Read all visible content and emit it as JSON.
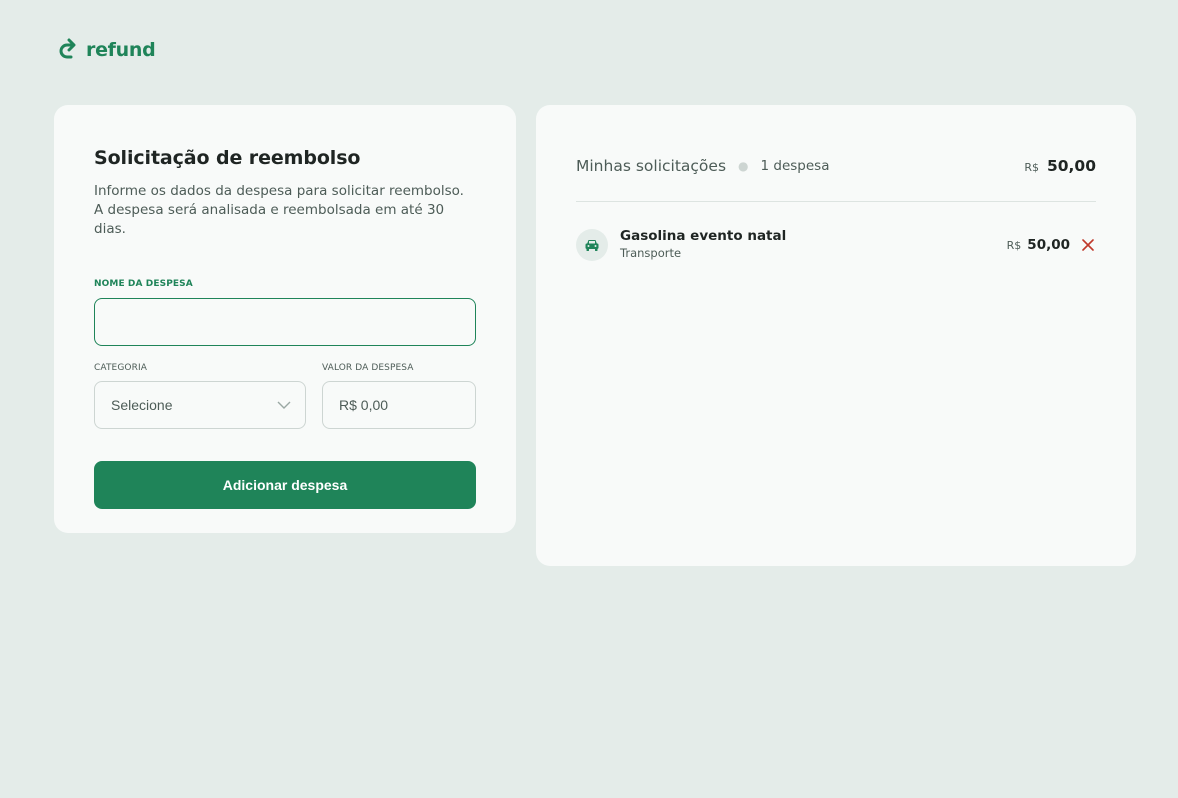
{
  "brand": {
    "name": "refund",
    "icon": "redo-arrow-icon",
    "color": "#1f8459"
  },
  "form": {
    "title": "Solicitação de reembolso",
    "description": "Informe os dados da despesa para solicitar reembolso. A despesa será analisada e reembolsada em até 30 dias.",
    "name_label": "NOME DA DESPESA",
    "name_value": "",
    "category_label": "CATEGORIA",
    "category_value": "Selecione",
    "amount_label": "VALOR DA DESPESA",
    "amount_placeholder": "R$ 0,00",
    "submit_label": "Adicionar despesa"
  },
  "list": {
    "title": "Minhas solicitações",
    "count_label": "1 despesa",
    "total_currency": "R$",
    "total_value": "50,00",
    "items": [
      {
        "name": "Gasolina evento natal",
        "category": "Transporte",
        "icon": "car-icon",
        "currency": "R$",
        "value": "50,00"
      }
    ]
  },
  "colors": {
    "accent": "#1f8459",
    "danger": "#c0392b",
    "background": "#e4ece9",
    "card": "#f8faf9"
  }
}
